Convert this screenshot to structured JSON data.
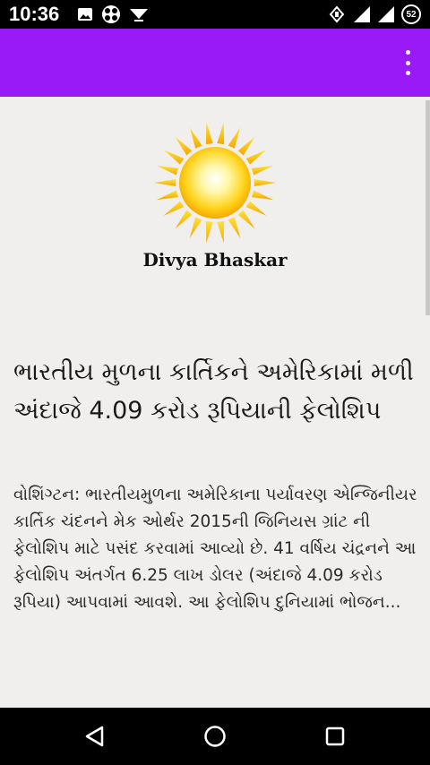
{
  "status_bar": {
    "time": "10:36",
    "battery_level": "52",
    "left_icons": [
      "image-icon",
      "game-controller-icon",
      "download-icon"
    ],
    "right_icons": [
      "vibrate-icon",
      "signal-icon",
      "signal-icon",
      "battery-icon"
    ]
  },
  "app_bar": {
    "color": "#9a19f7",
    "overflow_icon": "more-vert-icon"
  },
  "logo": {
    "text": "Divya Bhaskar",
    "icon": "sun-icon"
  },
  "article": {
    "title": "ભારતીય મુળના કાર્તિકને અમેરિકામાં મળી અંદાજે 4.09 કરોડ રૂપિયાની ફેલોશિપ",
    "body": "વોશિંગ્ટન: ભારતીયમુળના અમેરિકાના પર્યાવરણ એન્જિનીયર કાર્તિક ચંદનને મેક ઓર્થર 2015ની જિનિયસ ગ્રાંટ ની ફેલોશિપ માટે પસંદ કરવામાં આવ્યો છે. 41 વર્ષિય ચંદ્રનને આ ફેલોશિપ અંતર્ગત 6.25 લાખ ડોલર (અંદાજે 4.09 કરોડ રૂપિયા) આપવામાં આવશે. આ ફેલોશિપ દુનિયામાં ભોજન..."
  },
  "nav_bar": {
    "icons": [
      "back-icon",
      "home-icon",
      "recents-icon"
    ]
  }
}
